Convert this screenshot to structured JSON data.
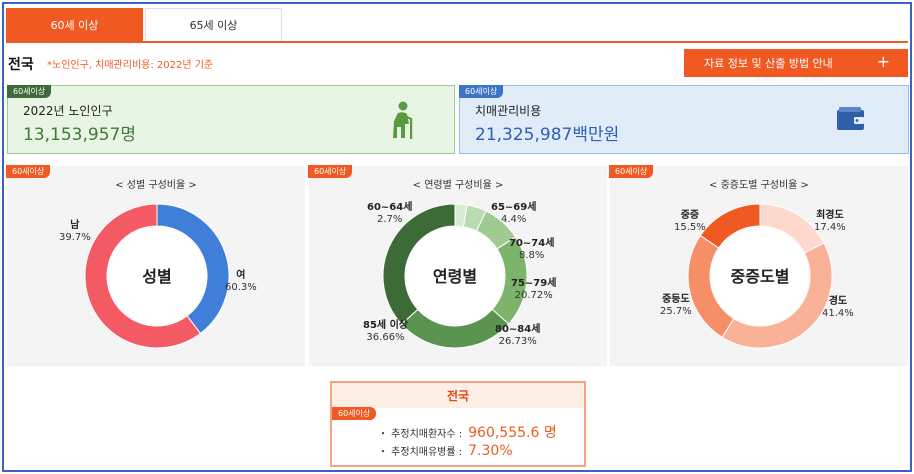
{
  "tabs": [
    {
      "label": "60세 이상",
      "active": true
    },
    {
      "label": "65세 이상",
      "active": false
    }
  ],
  "header": {
    "region": "전국",
    "note": "*노인인구, 치매관리비용: 2022년 기준",
    "info_button": "자료 정보 및 산출 방법 안내",
    "info_button_icon": "+"
  },
  "badge_label": "60세이상",
  "cards": {
    "population": {
      "label": "2022년 노인인구",
      "value": "13,153,957명",
      "icon": "elderly-person-icon"
    },
    "cost": {
      "label": "치매관리비용",
      "value": "21,325,987백만원",
      "icon": "wallet-icon"
    }
  },
  "colors": {
    "accent": "#f05a22",
    "frame": "#3a63c8",
    "green_card": "#e8f4e4",
    "blue_card": "#e1ecf9"
  },
  "chart_data": [
    {
      "type": "pie",
      "title": "< 성별 구성비율 >",
      "center_label": "성별",
      "slices": [
        {
          "name": "남",
          "value": 39.7,
          "display": "39.7%",
          "color": "#3f7fd9"
        },
        {
          "name": "여",
          "value": 60.3,
          "display": "60.3%",
          "color": "#f45a63"
        }
      ]
    },
    {
      "type": "pie",
      "title": "< 연령별 구성비율 >",
      "center_label": "연령별",
      "slices": [
        {
          "name": "60~64세",
          "value": 2.7,
          "display": "2.7%",
          "color": "#d7ecd0"
        },
        {
          "name": "65~69세",
          "value": 4.4,
          "display": "4.4%",
          "color": "#b9dcb0"
        },
        {
          "name": "70~74세",
          "value": 8.8,
          "display": "8.8%",
          "color": "#9fcb93"
        },
        {
          "name": "75~79세",
          "value": 20.72,
          "display": "20.72%",
          "color": "#7cb46c"
        },
        {
          "name": "80~84세",
          "value": 26.73,
          "display": "26.73%",
          "color": "#5a9450"
        },
        {
          "name": "85세 이상",
          "value": 36.66,
          "display": "36.66%",
          "color": "#3c6b37"
        }
      ]
    },
    {
      "type": "pie",
      "title": "< 중증도별 구성비율 >",
      "center_label": "중증도별",
      "slices": [
        {
          "name": "최경도",
          "value": 17.4,
          "display": "17.4%",
          "color": "#fcd9cc"
        },
        {
          "name": "경도",
          "value": 41.4,
          "display": "41.4%",
          "color": "#f9b298"
        },
        {
          "name": "중등도",
          "value": 25.7,
          "display": "25.7%",
          "color": "#f68e68"
        },
        {
          "name": "중증",
          "value": 15.5,
          "display": "15.5%",
          "color": "#f05a22"
        }
      ]
    }
  ],
  "summary": {
    "title": "전국",
    "rows": [
      {
        "label": "・ 추정치매환자수 :",
        "value": "960,555.6 명"
      },
      {
        "label": "・ 추정치매유병률 :",
        "value": "7.30%"
      }
    ]
  }
}
